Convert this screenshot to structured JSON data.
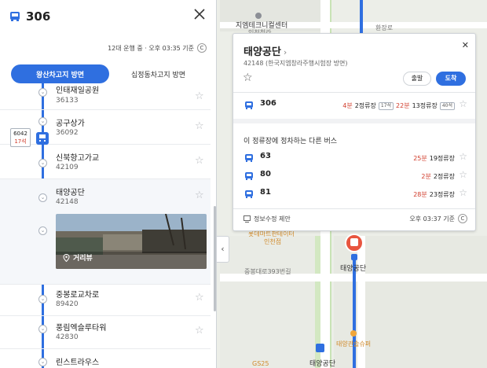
{
  "left_panel": {
    "route_number": "306",
    "status": "12대 운행 중 · 오후 03:35 기준",
    "tabs": [
      {
        "label": "왕산차고지 방면",
        "active": true
      },
      {
        "label": "십정동차고지 방면",
        "active": false
      }
    ],
    "stops": [
      {
        "name": "인태재일공원",
        "code": "36133"
      },
      {
        "name": "공구상가",
        "code": "36092"
      },
      {
        "name": "신북항고가교",
        "code": "42109"
      },
      {
        "name": "태양공단",
        "code": "42148"
      },
      {
        "name": "중봉로교차로",
        "code": "89420"
      },
      {
        "name": "풍림엑슬루타워",
        "code": "42830"
      },
      {
        "name": "린스트라우스",
        "code": ""
      }
    ],
    "bus_marker": {
      "plate": "6042",
      "seats": "17석"
    },
    "street_view_label": "거리뷰"
  },
  "stop_card": {
    "title": "태양공단",
    "subtitle": "42148 (한국지엠창라주행시험장 방면)",
    "depart_label": "출발",
    "arrive_label": "도착",
    "main_arrival": {
      "route": "306",
      "first_time": "4분",
      "first_stops": "2정류장",
      "first_seats": "17석",
      "second_time": "22분",
      "second_stops": "13정류장",
      "second_seats": "40석"
    },
    "other_title": "이 정류장에 정차하는 다른 버스",
    "other_buses": [
      {
        "route": "63",
        "time": "25분",
        "stops": "19정류장"
      },
      {
        "route": "80",
        "time": "2분",
        "stops": "2정류장"
      },
      {
        "route": "81",
        "time": "28분",
        "stops": "23정류장"
      }
    ],
    "footer_left": "정보수정 제안",
    "footer_right": "오후 03:37 기준"
  },
  "map": {
    "labels": {
      "top_poi": "지엠테크니컬센터",
      "top_poi2": "인천청라",
      "road_top": "환장로",
      "poi_mid": "롯데마트판테이터",
      "poi_mid2": "인천점",
      "road_mid": "중봉대로393번길",
      "stop_label": "태양공단",
      "bus_stop_bottom": "태양공단",
      "poi_bottom": "태양관솔슈퍼",
      "gs": "GS25"
    }
  },
  "colors": {
    "accent": "#2f6fe0",
    "alert": "#d03b2a",
    "map_pin": "#e8553f"
  }
}
